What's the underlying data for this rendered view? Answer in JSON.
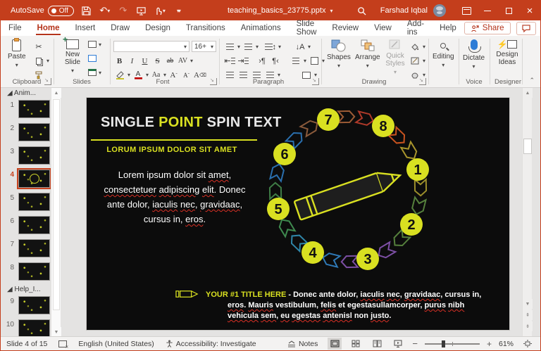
{
  "colors": {
    "titlebar_red": "#c43e1c",
    "accent_yellow": "#d9e021",
    "selection_orange": "#c8431f",
    "spell_red": "#d93025"
  },
  "titlebar": {
    "autosave_label": "AutoSave",
    "autosave_state": "Off",
    "filename": "teaching_basics_23775.pptx",
    "user_name": "Farshad Iqbal"
  },
  "ribbon": {
    "tabs": [
      "File",
      "Home",
      "Insert",
      "Draw",
      "Design",
      "Transitions",
      "Animations",
      "Slide Show",
      "Review",
      "View",
      "Add-ins",
      "Help"
    ],
    "active_tab": "Home",
    "share_label": "Share",
    "groups": {
      "clipboard": "Clipboard",
      "slides": "Slides",
      "font": "Font",
      "paragraph": "Paragraph",
      "drawing": "Drawing",
      "voice": "Voice",
      "designer": "Designer"
    },
    "buttons": {
      "paste": "Paste",
      "new_slide": "New Slide",
      "shapes": "Shapes",
      "arrange": "Arrange",
      "quick_styles": "Quick Styles",
      "editing": "Editing",
      "dictate": "Dictate",
      "design_ideas": "Design Ideas"
    },
    "font": {
      "name_value": "",
      "size_value": "16+",
      "bold": "B",
      "italic": "I",
      "underline": "U",
      "strike": "S",
      "strike2": "ab",
      "kerning": "AV",
      "case": "Aa",
      "grow": "A",
      "shrink": "A",
      "clear": "A"
    }
  },
  "thumbs": {
    "section_top": "Anim...",
    "section_bottom": "Help_I...",
    "slides": [
      "1",
      "2",
      "3",
      "4",
      "5",
      "6",
      "7",
      "8",
      "9",
      "10"
    ],
    "selected": "4"
  },
  "slide": {
    "title_segments": [
      {
        "t": "SINGLE "
      },
      {
        "t": "POINT",
        "cls": "hl"
      },
      {
        "t": " SPIN TEXT"
      }
    ],
    "subtitle": "LORUM IPSUM DOLOR SIT AMET",
    "body_segments": [
      {
        "t": "Lorem ipsum dolor sit "
      },
      {
        "t": "amet",
        "cls": "sp"
      },
      {
        "t": ", "
      },
      {
        "t": "consectetuer",
        "cls": "sp"
      },
      {
        "t": " "
      },
      {
        "t": "adipiscing",
        "cls": "sp"
      },
      {
        "t": " "
      },
      {
        "t": "elit",
        "cls": "sp"
      },
      {
        "t": ". Donec ante dolor, "
      },
      {
        "t": "iaculis",
        "cls": "sp"
      },
      {
        "t": " "
      },
      {
        "t": "nec",
        "cls": "sp"
      },
      {
        "t": ", "
      },
      {
        "t": "gravidaac",
        "cls": "sp"
      },
      {
        "t": ", cursus in, "
      },
      {
        "t": "eros",
        "cls": "sp"
      },
      {
        "t": "."
      }
    ],
    "footer_segments": [
      {
        "t": "YOUR #1 TITLE HERE",
        "cls": "hl"
      },
      {
        "t": " - Donec ante dolor, "
      },
      {
        "t": "iaculis",
        "cls": "sp"
      },
      {
        "t": " "
      },
      {
        "t": "nec",
        "cls": "sp"
      },
      {
        "t": ", "
      },
      {
        "t": "gravidaac",
        "cls": "sp"
      },
      {
        "t": ", cursus in, "
      },
      {
        "t": "eros",
        "cls": "sp"
      },
      {
        "t": ". "
      },
      {
        "t": "Mauris",
        "cls": "sp"
      },
      {
        "t": " vestibulum, "
      },
      {
        "t": "felis",
        "cls": "sp"
      },
      {
        "t": " et egestasullamcorper, "
      },
      {
        "t": "purus",
        "cls": "sp"
      },
      {
        "t": " "
      },
      {
        "t": "nibh",
        "cls": "sp"
      },
      {
        "t": " "
      },
      {
        "t": "vehicula",
        "cls": "sp"
      },
      {
        "t": " "
      },
      {
        "t": "sem",
        "cls": "sp"
      },
      {
        "t": ", "
      },
      {
        "t": "eu",
        "cls": "sp"
      },
      {
        "t": " "
      },
      {
        "t": "egestas",
        "cls": "sp"
      },
      {
        "t": " "
      },
      {
        "t": "antenisl",
        "cls": "sp"
      },
      {
        "t": " non "
      },
      {
        "t": "justo",
        "cls": "sp"
      },
      {
        "t": "."
      }
    ],
    "diagram": {
      "steps": [
        "1",
        "2",
        "3",
        "4",
        "5",
        "6",
        "7",
        "8"
      ],
      "ribbon_colors": [
        "#c8531f",
        "#a9952c",
        "#9c8f2b",
        "#55803c",
        "#55803c",
        "#7d4fa5",
        "#7d4fa5",
        "#2f7ab8",
        "#2f86a8",
        "#3f8a4f",
        "#3f7d46",
        "#2a6fae",
        "#2a6fae",
        "#8a5a3b",
        "#9c5b35",
        "#b03a2a"
      ]
    }
  },
  "statusbar": {
    "slide_indicator": "Slide 4 of 15",
    "language": "English (United States)",
    "accessibility": "Accessibility: Investigate",
    "notes_label": "Notes",
    "zoom_level": "61%"
  }
}
